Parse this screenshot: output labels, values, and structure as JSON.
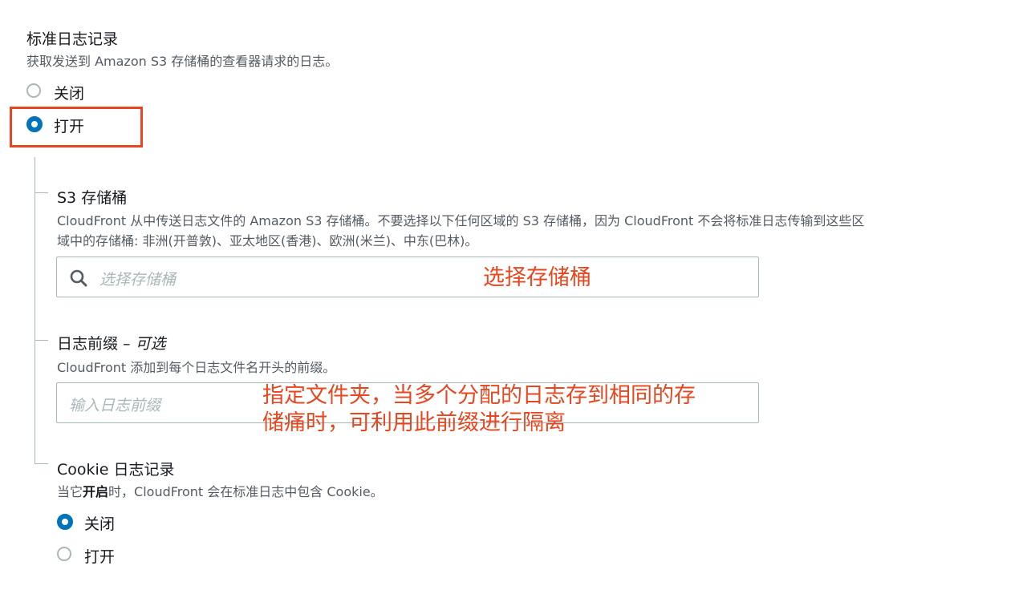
{
  "standard_logging": {
    "title": "标准日志记录",
    "description": "获取发送到 Amazon S3 存储桶的查看器请求的日志。",
    "options": [
      {
        "label": "关闭",
        "selected": false
      },
      {
        "label": "打开",
        "selected": true
      }
    ]
  },
  "s3_bucket": {
    "title": "S3 存储桶",
    "description_line1": "CloudFront 从中传送日志文件的 Amazon S3 存储桶。不要选择以下任何区域的 S3 存储桶，因为 CloudFront 不会将标准日志传输到这些区",
    "description_line2": "域中的存储桶: 非洲(开普敦)、亚太地区(香港)、欧洲(米兰)、中东(巴林)。",
    "placeholder": "选择存储桶",
    "annotation": "选择存储桶"
  },
  "log_prefix": {
    "title": "日志前缀",
    "title_sep": " – ",
    "optional": "可选",
    "description": "CloudFront 添加到每个日志文件名开头的前缀。",
    "placeholder": "输入日志前缀",
    "annotation_line1": "指定文件夹，当多个分配的日志存到相同的存",
    "annotation_line2": "储痛时，可利用此前缀进行隔离"
  },
  "cookie_logging": {
    "title": "Cookie 日志记录",
    "desc_before": "当它",
    "desc_bold": "开启",
    "desc_after": "时，CloudFront 会在标准日志中包含 Cookie。",
    "options": [
      {
        "label": "关闭",
        "selected": true
      },
      {
        "label": "打开",
        "selected": false
      }
    ]
  },
  "colors": {
    "accent": "#0073bb",
    "annotation": "#e8461e",
    "text": "#16191f",
    "muted": "#545b64"
  }
}
